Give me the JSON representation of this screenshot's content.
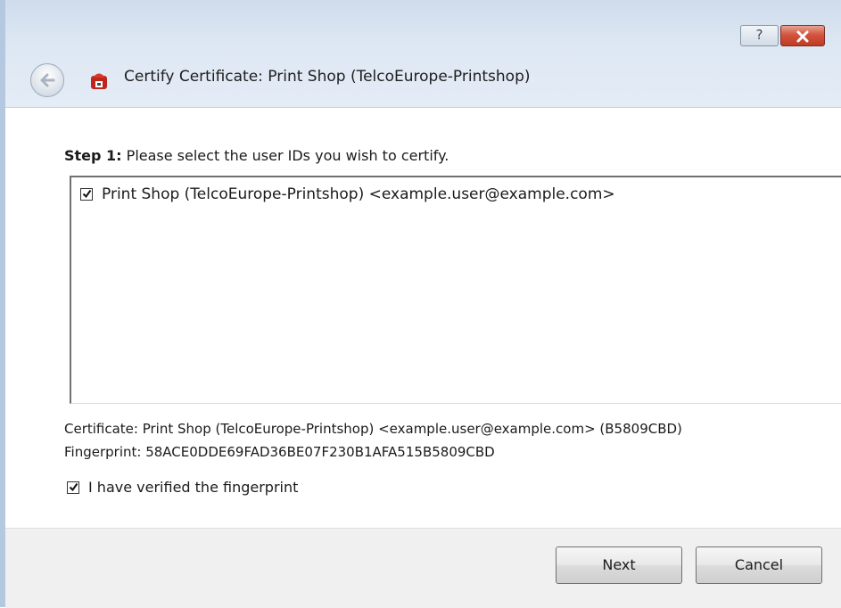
{
  "window": {
    "title": "Certify Certificate: Print Shop (TelcoEurope-Printshop)",
    "help_label": "?"
  },
  "step": {
    "label": "Step 1:",
    "text": "Please select the user IDs you wish to certify."
  },
  "user_ids": [
    {
      "label": "Print Shop (TelcoEurope-Printshop) <example.user@example.com>",
      "checked": true
    }
  ],
  "certificate_line": "Certificate: Print Shop (TelcoEurope-Printshop) <example.user@example.com> (B5809CBD)",
  "fingerprint_line": "Fingerprint: 58ACE0DDE69FAD36BE07F230B1AFA515B5809CBD",
  "verify": {
    "label": "I have verified the fingerprint",
    "checked": true
  },
  "buttons": {
    "next": "Next",
    "cancel": "Cancel"
  },
  "colors": {
    "close_red": "#c13a22",
    "titlebar": "#dde7f3",
    "footer": "#f0f0f0"
  }
}
